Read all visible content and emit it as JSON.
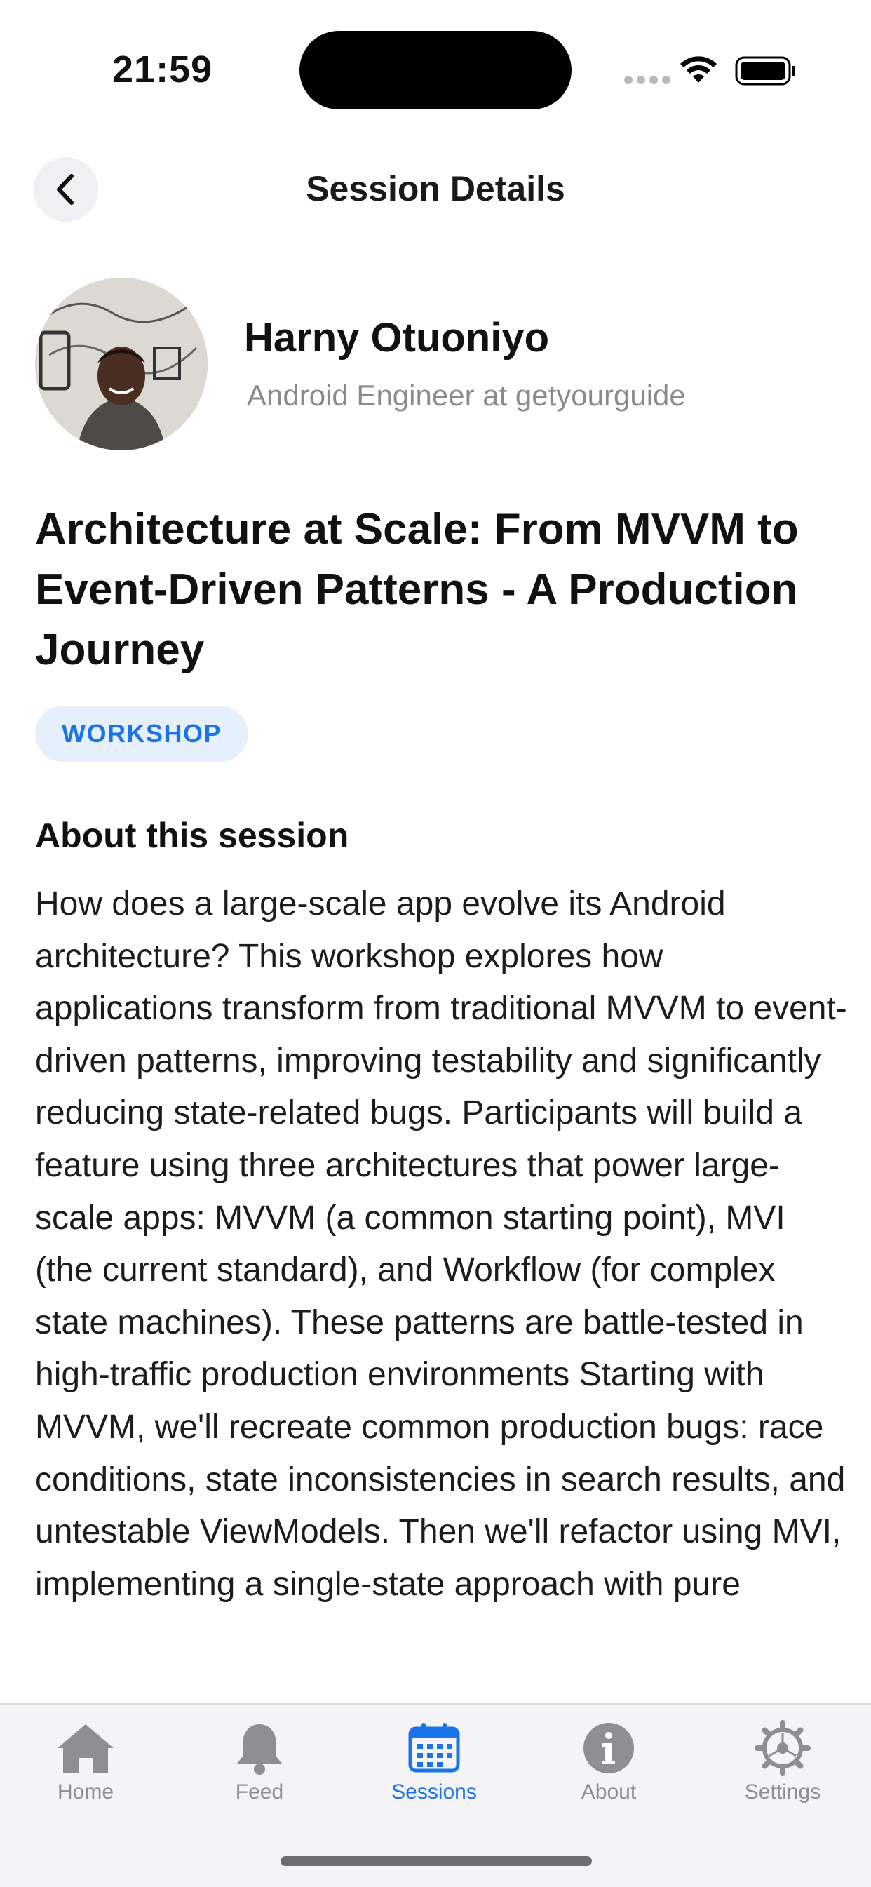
{
  "status_bar": {
    "time": "21:59"
  },
  "header": {
    "title": "Session Details"
  },
  "speaker": {
    "name": "Harny Otuoniyo",
    "role": "Android Engineer at getyourguide"
  },
  "session": {
    "title": "Architecture at Scale: From MVVM to Event-Driven Patterns - A Production Journey",
    "badge": "WORKSHOP",
    "about_heading": "About this session",
    "description": "How does a large-scale app evolve its Android architecture? This workshop explores how applications transform from traditional MVVM to event-driven patterns, improving testability and significantly reducing state-related bugs. Participants will build a feature using three architectures that power large-scale apps: MVVM (a common starting point), MVI (the current standard), and Workflow (for complex state machines). These patterns are battle-tested in high-traffic production environments Starting with MVVM, we'll recreate common production bugs: race conditions, state inconsistencies in search results, and untestable ViewModels. Then we'll refactor using MVI, implementing a single-state approach with pure"
  },
  "tab_bar": {
    "tabs": [
      {
        "label": "Home",
        "icon": "home-icon",
        "active": false
      },
      {
        "label": "Feed",
        "icon": "bell-icon",
        "active": false
      },
      {
        "label": "Sessions",
        "icon": "calendar-icon",
        "active": true
      },
      {
        "label": "About",
        "icon": "info-icon",
        "active": false
      },
      {
        "label": "Settings",
        "icon": "gear-icon",
        "active": false
      }
    ]
  },
  "colors": {
    "accent": "#1a73e8",
    "badge_background": "#e6f0fc",
    "inactive_tab": "#8e8e93",
    "secondary_text": "#8a8a8e"
  }
}
